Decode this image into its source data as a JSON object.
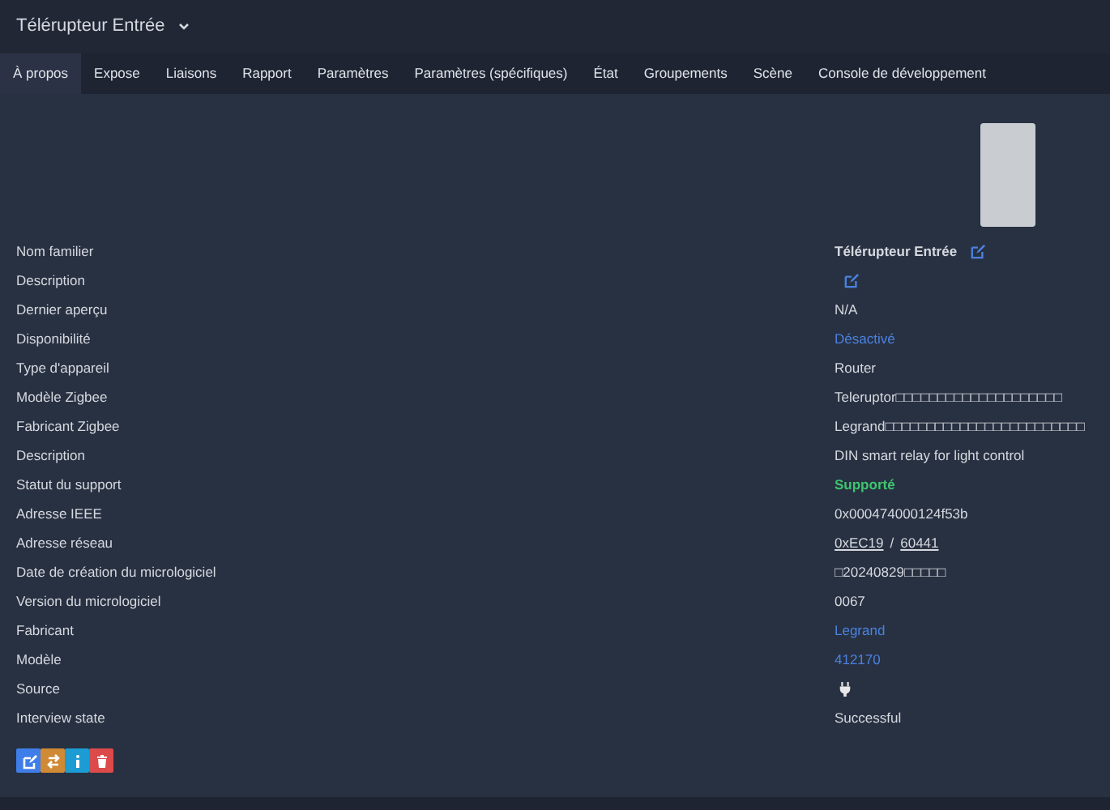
{
  "header": {
    "title": "Télérupteur Entrée"
  },
  "tabs": [
    {
      "label": "À propos",
      "selected": true
    },
    {
      "label": "Expose",
      "selected": false
    },
    {
      "label": "Liaisons",
      "selected": false
    },
    {
      "label": "Rapport",
      "selected": false
    },
    {
      "label": "Paramètres",
      "selected": false
    },
    {
      "label": "Paramètres (spécifiques)",
      "selected": false
    },
    {
      "label": "État",
      "selected": false
    },
    {
      "label": "Groupements",
      "selected": false
    },
    {
      "label": "Scène",
      "selected": false
    },
    {
      "label": "Console de développement",
      "selected": false
    }
  ],
  "details": [
    {
      "label": "Nom familier",
      "kind": "bold-edit",
      "value": "Télérupteur Entrée"
    },
    {
      "label": "Description",
      "kind": "edit"
    },
    {
      "label": "Dernier aperçu",
      "kind": "text",
      "value": "N/A"
    },
    {
      "label": "Disponibilité",
      "kind": "link",
      "value": "Désactivé"
    },
    {
      "label": "Type d'appareil",
      "kind": "text",
      "value": "Router"
    },
    {
      "label": "Modèle Zigbee",
      "kind": "text",
      "value": "Teleruptor□□□□□□□□□□□□□□□□□□□□"
    },
    {
      "label": "Fabricant Zigbee",
      "kind": "text",
      "value": "Legrand□□□□□□□□□□□□□□□□□□□□□□□□"
    },
    {
      "label": "Description",
      "kind": "text",
      "value": "DIN smart relay for light control"
    },
    {
      "label": "Statut du support",
      "kind": "success",
      "value": "Supporté"
    },
    {
      "label": "Adresse IEEE",
      "kind": "text",
      "value": "0x000474000124f53b"
    },
    {
      "label": "Adresse réseau",
      "kind": "links",
      "values": [
        "0xEC19",
        "60441"
      ],
      "separator": "/"
    },
    {
      "label": "Date de création du micrologiciel",
      "kind": "text",
      "value": "□20240829□□□□□"
    },
    {
      "label": "Version du micrologiciel",
      "kind": "text",
      "value": "0067"
    },
    {
      "label": "Fabricant",
      "kind": "link",
      "value": "Legrand"
    },
    {
      "label": "Modèle",
      "kind": "link",
      "value": "412170"
    },
    {
      "label": "Source",
      "kind": "plug"
    },
    {
      "label": "Interview state",
      "kind": "text",
      "value": "Successful"
    }
  ],
  "actions": [
    {
      "kind": "edit"
    },
    {
      "kind": "swap"
    },
    {
      "kind": "info"
    },
    {
      "kind": "delete"
    }
  ]
}
